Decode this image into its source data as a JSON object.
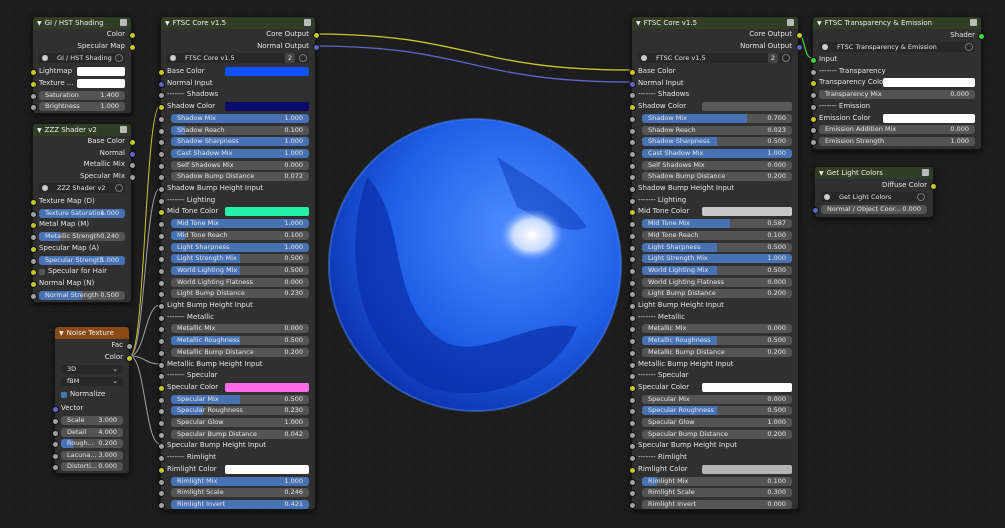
{
  "gi": {
    "title": "GI / HST Shading",
    "outputs": [
      "Color",
      "Specular Map"
    ],
    "group_name": "GI / HST Shading",
    "inputs": {
      "lightmap": "Lightmap",
      "texture": "Texture ..."
    },
    "fields": [
      {
        "label": "Saturation",
        "value": "1.400"
      },
      {
        "label": "Brightness",
        "value": "1.000"
      }
    ]
  },
  "zzz": {
    "title": "ZZZ Shader v2",
    "outputs": [
      "Base Color",
      "Normal",
      "Metallic Mix",
      "Specular Mix"
    ],
    "group_name": "ZZZ Shader v2",
    "rows": [
      {
        "label": "Texture Map (D)"
      },
      {
        "label": "Texture Saturation",
        "value": "1.000",
        "field": true,
        "fill": 1.0
      },
      {
        "label": "Metal Map (M)"
      },
      {
        "label": "Metallic Strength",
        "value": "0.240",
        "field": true,
        "fill": 0.24
      },
      {
        "label": "Specular Map (A)"
      },
      {
        "label": "Specular Strength",
        "value": "1.000",
        "field": true,
        "fill": 1.0
      },
      {
        "label": "Specular for Hair",
        "check": true
      },
      {
        "label": "Normal Map (N)"
      },
      {
        "label": "Normal Strength",
        "value": "0.500",
        "field": true,
        "fill": 0.5
      }
    ]
  },
  "noise": {
    "title": "Noise Texture",
    "outputs": [
      "Fac",
      "Color"
    ],
    "dim": "3D",
    "type": "fBM",
    "normalize": "Normalize",
    "vector": "Vector",
    "fields": [
      {
        "label": "Scale",
        "value": "3.000",
        "fill": 0
      },
      {
        "label": "Detail",
        "value": "4.000",
        "fill": 0
      },
      {
        "label": "Rough...",
        "value": "0.200",
        "fill": 0.2
      },
      {
        "label": "Lacuna...",
        "value": "3.000",
        "fill": 0
      },
      {
        "label": "Distorti...",
        "value": "0.000",
        "fill": 0
      }
    ]
  },
  "core1": {
    "title": "FTSC Core v1.5",
    "outputs": [
      "Core Output",
      "Normal Output"
    ],
    "group_name": "FTSC Core v1.5",
    "users": "2",
    "rows": [
      {
        "label": "Base Color",
        "kind": "color",
        "color": "#0f52ff",
        "sock": "yellow"
      },
      {
        "label": "Normal Input",
        "kind": "label",
        "sock": "blue"
      },
      {
        "label": "------- Shadows",
        "kind": "label",
        "sock": "grey"
      },
      {
        "label": "Shadow Color",
        "kind": "color",
        "color": "#0b0b6b",
        "sock": "yellow"
      },
      {
        "label": "Shadow Mix",
        "value": "1.000",
        "fill": 1.0,
        "kind": "field",
        "sock": "grey"
      },
      {
        "label": "Shadow Reach",
        "value": "0.100",
        "fill": 0.1,
        "kind": "field",
        "sock": "grey"
      },
      {
        "label": "Shadow Sharpness",
        "value": "1.000",
        "fill": 1.0,
        "kind": "field",
        "sock": "grey"
      },
      {
        "label": "Cast Shadow Mix",
        "value": "1.000",
        "fill": 1.0,
        "kind": "field",
        "sock": "grey"
      },
      {
        "label": "Self Shadows Mix",
        "value": "0.000",
        "fill": 0,
        "kind": "field",
        "sock": "grey"
      },
      {
        "label": "Shadow Bump Distance",
        "value": "0.072",
        "fill": 0,
        "kind": "field",
        "sock": "grey"
      },
      {
        "label": "Shadow Bump Height Input",
        "kind": "label",
        "sock": "grey"
      },
      {
        "label": "------- Lighting",
        "kind": "label",
        "sock": "grey"
      },
      {
        "label": "Mid Tone Color",
        "kind": "color",
        "color": "#21f2a4",
        "sock": "yellow"
      },
      {
        "label": "Mid Tone Mix",
        "value": "1.000",
        "fill": 1.0,
        "kind": "field",
        "sock": "grey"
      },
      {
        "label": "Mid Tone Reach",
        "value": "0.100",
        "fill": 0.1,
        "kind": "field",
        "sock": "grey"
      },
      {
        "label": "Light Sharpness",
        "value": "1.000",
        "fill": 1.0,
        "kind": "field",
        "sock": "grey"
      },
      {
        "label": "Light Strength Mix",
        "value": "0.500",
        "fill": 0.5,
        "kind": "field",
        "sock": "grey"
      },
      {
        "label": "World Lighting Mix",
        "value": "0.500",
        "fill": 0.5,
        "kind": "field",
        "sock": "grey"
      },
      {
        "label": "World Lighting Flatness",
        "value": "0.000",
        "fill": 0,
        "kind": "field",
        "sock": "grey"
      },
      {
        "label": "Light Bump Distance",
        "value": "0.230",
        "fill": 0,
        "kind": "field",
        "sock": "grey"
      },
      {
        "label": "Light Bump Height Input",
        "kind": "label",
        "sock": "grey"
      },
      {
        "label": "------- Metallic",
        "kind": "label",
        "sock": "grey"
      },
      {
        "label": "Metallic Mix",
        "value": "0.000",
        "fill": 0,
        "kind": "field",
        "sock": "grey"
      },
      {
        "label": "Metallic Roughness",
        "value": "0.500",
        "fill": 0.5,
        "kind": "field",
        "sock": "grey"
      },
      {
        "label": "Metallic Bump Distance",
        "value": "0.200",
        "fill": 0,
        "kind": "field",
        "sock": "grey"
      },
      {
        "label": "Metallic Bump Height Input",
        "kind": "label",
        "sock": "grey"
      },
      {
        "label": "------- Specular",
        "kind": "label",
        "sock": "grey"
      },
      {
        "label": "Specular Color",
        "kind": "color",
        "color": "#ff6be6",
        "sock": "yellow"
      },
      {
        "label": "Specular Mix",
        "value": "0.500",
        "fill": 0.5,
        "kind": "field",
        "sock": "grey"
      },
      {
        "label": "Specular Roughness",
        "value": "0.230",
        "fill": 0.23,
        "kind": "field",
        "sock": "grey"
      },
      {
        "label": "Specular Glow",
        "value": "1.000",
        "fill": 0,
        "kind": "field",
        "sock": "grey"
      },
      {
        "label": "Specular Bump Distance",
        "value": "0.042",
        "fill": 0,
        "kind": "field",
        "sock": "grey"
      },
      {
        "label": "Specular Bump Height Input",
        "kind": "label",
        "sock": "grey"
      },
      {
        "label": "------- Rimlight",
        "kind": "label",
        "sock": "grey"
      },
      {
        "label": "Rimlight Color",
        "kind": "color",
        "color": "#ffffff",
        "sock": "yellow"
      },
      {
        "label": "Rimlight Mix",
        "value": "1.000",
        "fill": 1.0,
        "kind": "field",
        "sock": "grey"
      },
      {
        "label": "Rimlight Scale",
        "value": "0.246",
        "fill": 0,
        "kind": "field",
        "sock": "grey"
      },
      {
        "label": "Rimlight Invert",
        "value": "0.421",
        "fill": 1.0,
        "kind": "field",
        "sock": "grey"
      }
    ]
  },
  "core2": {
    "title": "FTSC Core v1.5",
    "outputs": [
      "Core Output",
      "Normal Output"
    ],
    "group_name": "FTSC Core v1.5",
    "users": "2",
    "rows": [
      {
        "label": "Base Color",
        "kind": "label",
        "sock": "yellow"
      },
      {
        "label": "Normal Input",
        "kind": "label",
        "sock": "blue"
      },
      {
        "label": "------- Shadows",
        "kind": "label",
        "sock": "grey"
      },
      {
        "label": "Shadow Color",
        "kind": "color",
        "color": "#5a5a5a",
        "sock": "yellow"
      },
      {
        "label": "Shadow Mix",
        "value": "0.700",
        "fill": 0.7,
        "kind": "field",
        "sock": "grey"
      },
      {
        "label": "Shadow Reach",
        "value": "0.023",
        "fill": 0,
        "kind": "field",
        "sock": "grey"
      },
      {
        "label": "Shadow Sharpness",
        "value": "0.500",
        "fill": 0.5,
        "kind": "field",
        "sock": "grey"
      },
      {
        "label": "Cast Shadow Mix",
        "value": "1.000",
        "fill": 1.0,
        "kind": "field",
        "sock": "grey"
      },
      {
        "label": "Self Shadows Mix",
        "value": "0.000",
        "fill": 0,
        "kind": "field",
        "sock": "grey"
      },
      {
        "label": "Shadow Bump Distance",
        "value": "0.200",
        "fill": 0,
        "kind": "field",
        "sock": "grey"
      },
      {
        "label": "Shadow Bump Height Input",
        "kind": "label",
        "sock": "grey"
      },
      {
        "label": "------- Lighting",
        "kind": "label",
        "sock": "grey"
      },
      {
        "label": "Mid Tone Color",
        "kind": "color",
        "color": "#c8c8c8",
        "sock": "yellow"
      },
      {
        "label": "Mid Tone Mix",
        "value": "0.587",
        "fill": 0.587,
        "kind": "field",
        "sock": "grey"
      },
      {
        "label": "Mid Tone Reach",
        "value": "0.100",
        "fill": 0,
        "kind": "field",
        "sock": "grey"
      },
      {
        "label": "Light Sharpness",
        "value": "0.500",
        "fill": 0.5,
        "kind": "field",
        "sock": "grey"
      },
      {
        "label": "Light Strength Mix",
        "value": "1.000",
        "fill": 1.0,
        "kind": "field",
        "sock": "grey"
      },
      {
        "label": "World Lighting Mix",
        "value": "0.500",
        "fill": 0.5,
        "kind": "field",
        "sock": "grey"
      },
      {
        "label": "World Lighting Flatness",
        "value": "0.000",
        "fill": 0,
        "kind": "field",
        "sock": "grey"
      },
      {
        "label": "Light Bump Distance",
        "value": "0.200",
        "fill": 0,
        "kind": "field",
        "sock": "grey"
      },
      {
        "label": "Light Bump Height Input",
        "kind": "label",
        "sock": "grey"
      },
      {
        "label": "------- Metallic",
        "kind": "label",
        "sock": "grey"
      },
      {
        "label": "Metallic Mix",
        "value": "0.000",
        "fill": 0,
        "kind": "field",
        "sock": "grey"
      },
      {
        "label": "Metallic Roughness",
        "value": "0.500",
        "fill": 0.5,
        "kind": "field",
        "sock": "grey"
      },
      {
        "label": "Metallic Bump Distance",
        "value": "0.200",
        "fill": 0,
        "kind": "field",
        "sock": "grey"
      },
      {
        "label": "Metallic Bump Height Input",
        "kind": "label",
        "sock": "grey"
      },
      {
        "label": "------- Specular",
        "kind": "label",
        "sock": "grey"
      },
      {
        "label": "Specular Color",
        "kind": "color",
        "color": "#ffffff",
        "sock": "yellow"
      },
      {
        "label": "Specular Mix",
        "value": "0.000",
        "fill": 0,
        "kind": "field",
        "sock": "grey"
      },
      {
        "label": "Specular Roughness",
        "value": "0.500",
        "fill": 0.5,
        "kind": "field",
        "sock": "grey"
      },
      {
        "label": "Specular Glow",
        "value": "1.000",
        "fill": 0,
        "kind": "field",
        "sock": "grey"
      },
      {
        "label": "Specular Bump Distance",
        "value": "0.200",
        "fill": 0,
        "kind": "field",
        "sock": "grey"
      },
      {
        "label": "Specular Bump Height Input",
        "kind": "label",
        "sock": "grey"
      },
      {
        "label": "------- Rimlight",
        "kind": "label",
        "sock": "grey"
      },
      {
        "label": "Rimlight Color",
        "kind": "color",
        "color": "#b4b4b4",
        "sock": "yellow"
      },
      {
        "label": "Rimlight Mix",
        "value": "0.100",
        "fill": 0.1,
        "kind": "field",
        "sock": "grey"
      },
      {
        "label": "Rimlight Scale",
        "value": "0.300",
        "fill": 0,
        "kind": "field",
        "sock": "grey"
      },
      {
        "label": "Rimlight Invert",
        "value": "0.000",
        "fill": 0,
        "kind": "field",
        "sock": "grey"
      }
    ]
  },
  "trans": {
    "title": "FTSC Transparency & Emission",
    "output": "Shader",
    "group_name": "FTSC Transparency & Emission",
    "rows": [
      {
        "label": "Input",
        "kind": "label",
        "sock": "green"
      },
      {
        "label": "------- Transparency",
        "kind": "label",
        "sock": "grey"
      },
      {
        "label": "Transparency Color",
        "kind": "color",
        "color": "#ffffff",
        "sock": "yellow"
      },
      {
        "label": "Transparency Mix",
        "value": "0.000",
        "fill": 0,
        "kind": "field",
        "sock": "grey"
      },
      {
        "label": "------- Emission",
        "kind": "label",
        "sock": "grey"
      },
      {
        "label": "Emission Color",
        "kind": "color",
        "color": "#ffffff",
        "sock": "yellow"
      },
      {
        "label": "Emission Addition Mix",
        "value": "0.000",
        "fill": 0,
        "kind": "field",
        "sock": "grey"
      },
      {
        "label": "Emission Strength",
        "value": "1.000",
        "fill": 0,
        "kind": "field",
        "sock": "grey"
      }
    ]
  },
  "glc": {
    "title": "Get Light Colors",
    "output": "Diffuse Color",
    "group_name": "Get Light Colors",
    "field": {
      "label": "Normal / Object Coor...",
      "value": "0.000"
    }
  },
  "colors": {
    "sphere_main": "#2b6cf5",
    "sphere_dark": "#0a2ea8",
    "wire_yellow": "#c7c729",
    "wire_blue": "#6363c7"
  }
}
